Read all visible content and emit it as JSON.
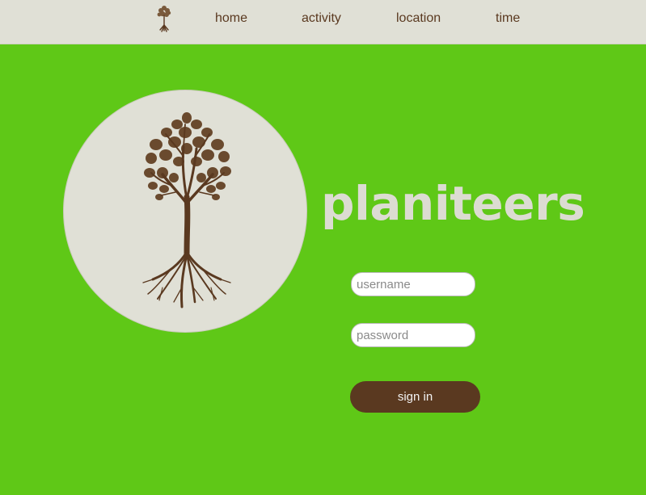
{
  "nav": {
    "logo_icon": "tree-icon",
    "links": [
      {
        "label": "home"
      },
      {
        "label": "activity"
      },
      {
        "label": "location"
      },
      {
        "label": "time"
      }
    ]
  },
  "hero": {
    "image_icon": "tree-with-roots-icon",
    "brand": "planiteers"
  },
  "login": {
    "username_placeholder": "username",
    "username_value": "",
    "password_placeholder": "password",
    "password_value": "",
    "signin_label": "sign in"
  },
  "colors": {
    "background": "#5fc817",
    "navbar": "#e0e0d6",
    "brown": "#5a3920",
    "title": "#dcdcd2"
  }
}
